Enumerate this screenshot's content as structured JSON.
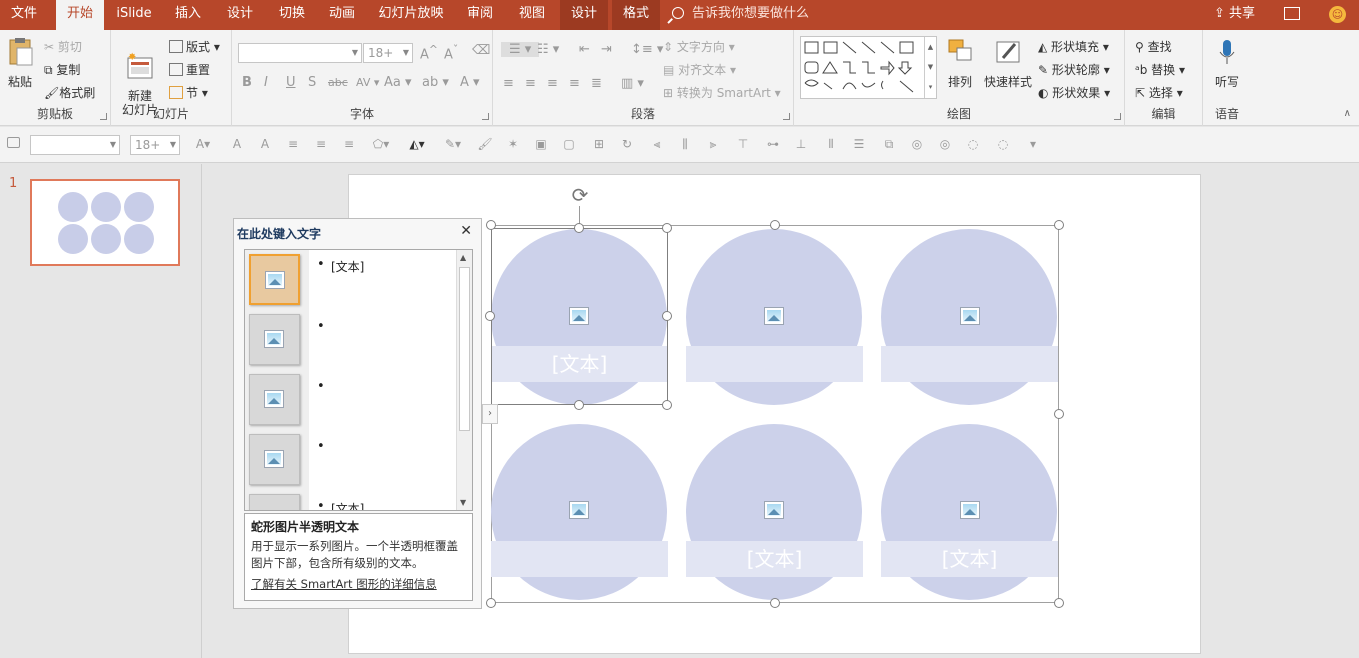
{
  "tabs": [
    "文件",
    "开始",
    "iSlide",
    "插入",
    "设计",
    "切换",
    "动画",
    "幻灯片放映",
    "审阅",
    "视图",
    "设计",
    "格式"
  ],
  "active_tab": "开始",
  "tell_me": "告诉我你想要做什么",
  "share": "共享",
  "ribbon": {
    "clipboard": {
      "label": "剪贴板",
      "paste": "粘贴",
      "cut": "剪切",
      "copy": "复制",
      "format_painter": "格式刷"
    },
    "slides": {
      "label": "幻灯片",
      "new_slide": "新建\n幻灯片",
      "layout": "版式",
      "reset": "重置",
      "section": "节"
    },
    "font": {
      "label": "字体",
      "size": "18+"
    },
    "paragraph": {
      "label": "段落",
      "text_direction": "文字方向",
      "align_text": "对齐文本",
      "convert_smartart": "转换为 SmartArt"
    },
    "drawing": {
      "label": "绘图",
      "arrange": "排列",
      "quick_styles": "快速样式",
      "shape_fill": "形状填充",
      "shape_outline": "形状轮廓",
      "shape_effects": "形状效果"
    },
    "editing": {
      "label": "编辑",
      "find": "查找",
      "replace": "替换",
      "select": "选择"
    },
    "voice": {
      "label": "语音",
      "dictate": "听写"
    }
  },
  "toolbar2": {
    "font_size": "18+"
  },
  "thumbnail": {
    "slide_number": "1"
  },
  "smartart": {
    "items": [
      {
        "text": "[文本]"
      },
      {
        "text": ""
      },
      {
        "text": ""
      },
      {
        "text": ""
      },
      {
        "text": "[文本]"
      },
      {
        "text": "[文本]"
      }
    ]
  },
  "text_pane": {
    "title": "在此处键入文字",
    "bullets": [
      "[文本]",
      "",
      "",
      "",
      "[文本]"
    ],
    "desc_title": "蛇形图片半透明文本",
    "desc_text": "用于显示一系列图片。一个半透明框覆盖图片下部，包含所有级别的文本。",
    "learn_more": "了解有关 SmartArt 图形的详细信息"
  },
  "colors": {
    "accent": "#b7472a",
    "circle": "#ccd1ea",
    "band": "#e2e5f3",
    "thumb_border": "#e0795a"
  }
}
